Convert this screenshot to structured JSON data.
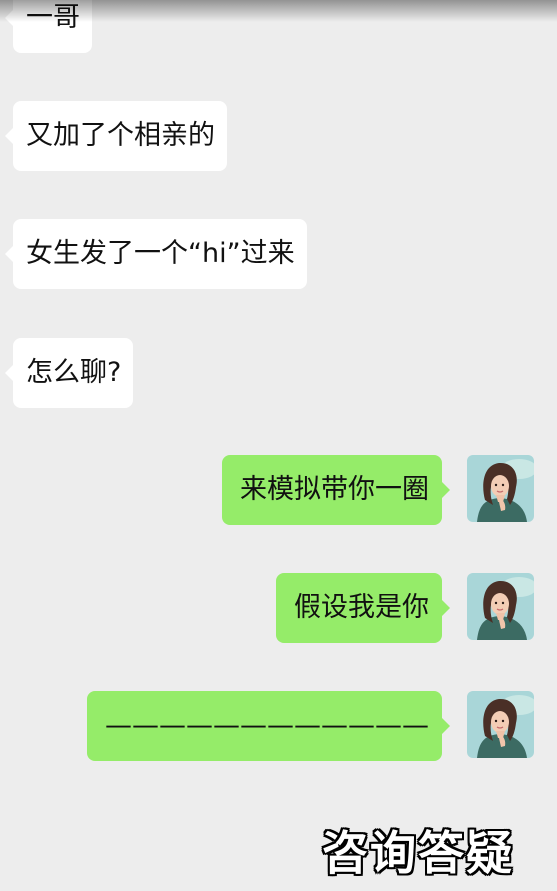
{
  "messages": [
    {
      "side": "left",
      "text": "一哥"
    },
    {
      "side": "left",
      "text": "又加了个相亲的"
    },
    {
      "side": "left",
      "text": "女生发了一个“hi”过来"
    },
    {
      "side": "left",
      "text": "怎么聊?"
    },
    {
      "side": "right",
      "text": "来模拟带你一圈"
    },
    {
      "side": "right",
      "text": "假设我是你"
    },
    {
      "side": "right",
      "text": "————————————"
    }
  ],
  "overlay": {
    "caption": "咨询答疑"
  },
  "colors": {
    "background": "#ededed",
    "incoming_bubble": "#ffffff",
    "outgoing_bubble": "#95ec69"
  },
  "icons": {
    "avatar": "woman-portrait-avatar"
  }
}
